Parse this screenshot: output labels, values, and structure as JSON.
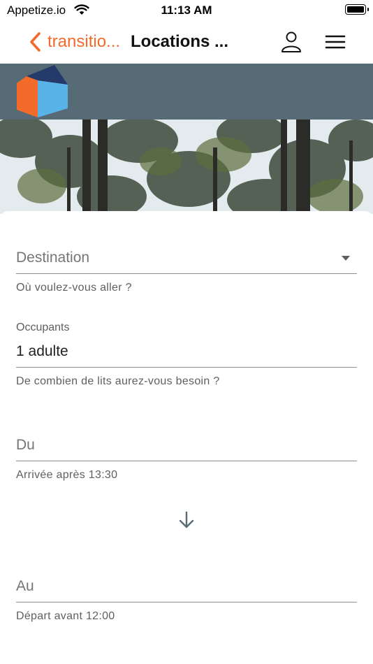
{
  "status_bar": {
    "carrier": "Appetize.io",
    "time": "11:13 AM"
  },
  "nav": {
    "back_label": "transitio...",
    "title": "Locations ...",
    "icons": {
      "back": "chevron-left-icon",
      "user": "user-icon",
      "menu": "hamburger-menu-icon"
    },
    "accent_color": "#f26b2a"
  },
  "brand": {
    "background_color": "#566b76",
    "logo_colors": [
      "#f26b2a",
      "#5ab3e8",
      "#233a6b"
    ]
  },
  "form": {
    "destination": {
      "placeholder": "Destination",
      "helper": "Où voulez-vous aller ?"
    },
    "occupants": {
      "label": "Occupants",
      "value": "1 adulte",
      "helper": "De combien de lits aurez-vous besoin ?"
    },
    "arrival": {
      "placeholder": "Du",
      "helper": "Arrivée après 13:30"
    },
    "departure": {
      "placeholder": "Au",
      "helper": "Départ avant 12:00"
    },
    "arrow_icon": "arrow-down-icon"
  }
}
